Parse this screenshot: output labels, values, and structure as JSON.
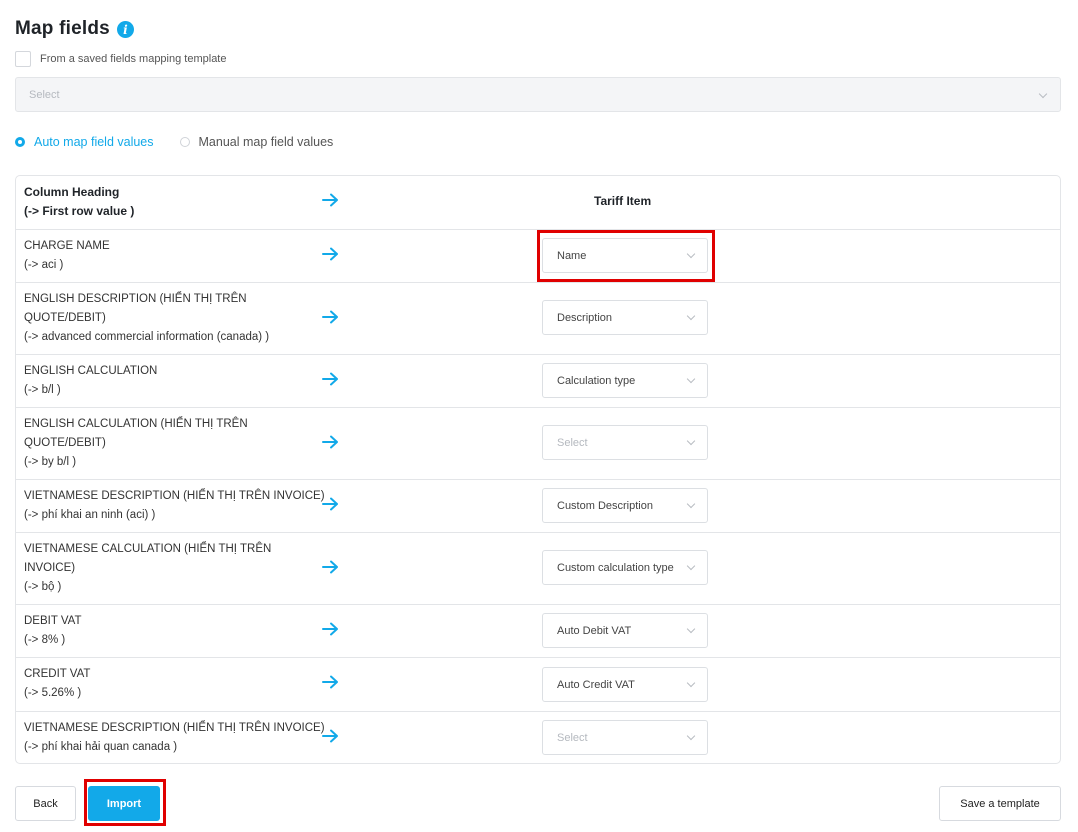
{
  "header": {
    "title": "Map fields",
    "info_glyph": "i"
  },
  "template": {
    "checkbox_label": "From a saved fields mapping template",
    "select_placeholder": "Select"
  },
  "mode": {
    "auto_label": "Auto map field values",
    "manual_label": "Manual map field values",
    "selected": "auto"
  },
  "table": {
    "header": {
      "column_line1": "Column Heading",
      "column_line2": "(-> First row value )",
      "tariff": "Tariff Item"
    },
    "rows": [
      {
        "lines": [
          "CHARGE NAME",
          "(-> aci )"
        ],
        "value": "Name",
        "placeholder": false
      },
      {
        "lines": [
          "ENGLISH DESCRIPTION (HIỂN THỊ TRÊN",
          "QUOTE/DEBIT)",
          "(-> advanced commercial information (canada) )"
        ],
        "value": "Description",
        "placeholder": false
      },
      {
        "lines": [
          "ENGLISH CALCULATION",
          "(-> b/l )"
        ],
        "value": "Calculation type",
        "placeholder": false
      },
      {
        "lines": [
          "ENGLISH CALCULATION (HIỂN THỊ TRÊN",
          "QUOTE/DEBIT)",
          "(-> by b/l )"
        ],
        "value": "Select",
        "placeholder": true
      },
      {
        "lines": [
          "VIETNAMESE DESCRIPTION (HIỂN THỊ TRÊN INVOICE)",
          "(-> phí khai an ninh (aci) )"
        ],
        "value": "Custom Description",
        "placeholder": false
      },
      {
        "lines": [
          "VIETNAMESE CALCULATION (HIỂN THỊ TRÊN",
          "INVOICE)",
          "(-> bộ )"
        ],
        "value": "Custom calculation type",
        "placeholder": false
      },
      {
        "lines": [
          "DEBIT VAT",
          "(-> 8% )"
        ],
        "value": "Auto Debit VAT",
        "placeholder": false
      },
      {
        "lines": [
          "CREDIT VAT",
          "(-> 5.26% )"
        ],
        "value": "Auto Credit VAT",
        "placeholder": false
      },
      {
        "lines": [
          "VIETNAMESE DESCRIPTION (HIỂN THỊ TRÊN INVOICE)",
          "(-> phí khai hải quan canada )"
        ],
        "value": "Select",
        "placeholder": true
      }
    ]
  },
  "footer": {
    "back_label": "Back",
    "import_label": "Import",
    "save_label": "Save a template"
  },
  "colors": {
    "accent": "#12a9e9",
    "highlight": "#e00000",
    "border": "#e3e5e8"
  },
  "icons": {
    "arrow": "arrow-right-icon",
    "info": "info-icon",
    "dropdown": "chevron-down-icon"
  }
}
